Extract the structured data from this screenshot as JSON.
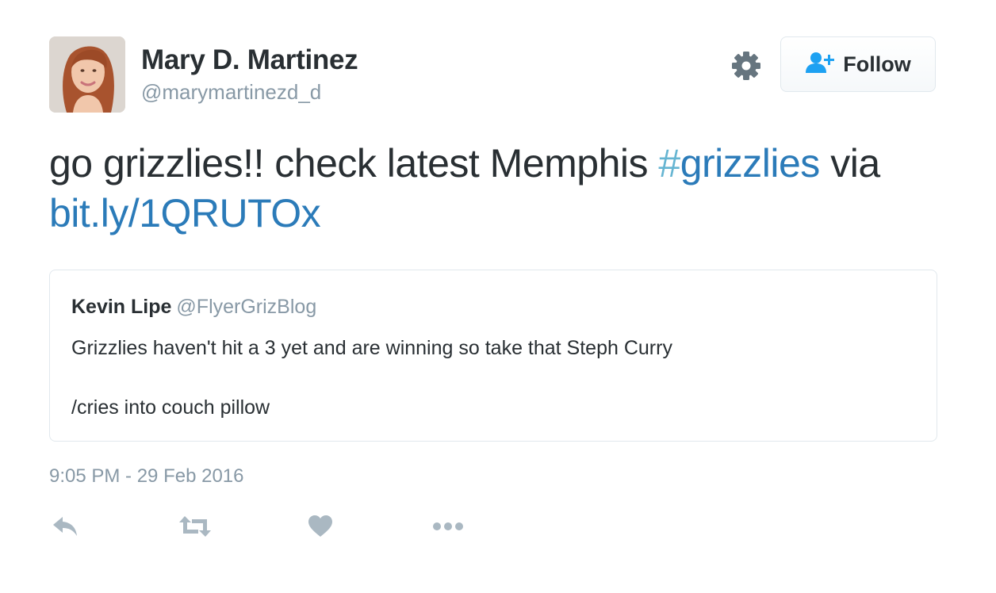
{
  "author": {
    "display_name": "Mary D. Martinez",
    "screen_name": "@marymartinezd_d"
  },
  "follow_button": {
    "label": "Follow"
  },
  "tweet": {
    "text_before": "go grizzlies!! check latest Memphis ",
    "hashtag_symbol": "#",
    "hashtag_text": "grizzlies",
    "text_after": " via ",
    "link": "bit.ly/1QRUTOx"
  },
  "quoted_tweet": {
    "name": "Kevin Lipe",
    "handle": "@FlyerGrizBlog",
    "line1": "Grizzlies haven't hit a 3 yet and are winning so take that Steph Curry",
    "line2": "/cries into couch pillow"
  },
  "timestamp": "9:05 PM - 29 Feb 2016",
  "actions": {
    "icons": [
      "reply-icon",
      "retweet-icon",
      "like-icon",
      "more-icon"
    ]
  },
  "colors": {
    "text": "#292f33",
    "secondary": "#8899a6",
    "link": "#2b7bb9",
    "hashtag_symbol": "#66b5d2",
    "follow_icon": "#1da1f2",
    "action_icon": "#aab8c2",
    "border": "#e1e8ed"
  }
}
